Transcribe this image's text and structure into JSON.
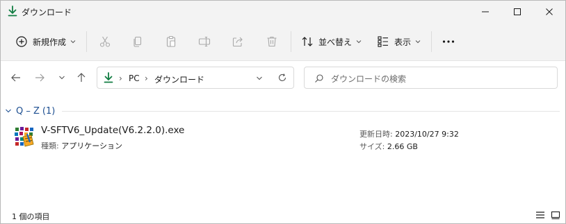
{
  "window": {
    "title": "ダウンロード",
    "icons": {
      "title": "download-icon",
      "minimize": "minimize-icon",
      "maximize": "maximize-icon",
      "close": "close-icon"
    }
  },
  "toolbar": {
    "new_label": "新規作成",
    "sort_label": "並べ替え",
    "view_label": "表示",
    "icons": [
      "plus-circle-icon",
      "scissors-icon",
      "copy-icon",
      "paste-icon",
      "rename-icon",
      "share-icon",
      "trash-icon",
      "sort-icon",
      "view-list-icon",
      "more-icon"
    ]
  },
  "address_bar": {
    "breadcrumb": [
      "PC",
      "ダウンロード"
    ],
    "separator": "›"
  },
  "search": {
    "placeholder": "ダウンロードの検索"
  },
  "content": {
    "group": {
      "label": "Q – Z",
      "count": "(1)"
    },
    "files": [
      {
        "name": "V-SFTV6_Update(V6.2.2.0).exe",
        "type_key": "種類:",
        "type_value": "アプリケーション",
        "modified_key": "更新日時:",
        "modified_value": "2023/10/27 9:32",
        "size_key": "サイズ:",
        "size_value": "2.66 GB"
      }
    ]
  },
  "status_bar": {
    "item_count": "1 個の項目"
  },
  "colors": {
    "accent_green": "#107c41",
    "group_blue": "#1d4f91",
    "chrome": "#f3f3f3"
  }
}
